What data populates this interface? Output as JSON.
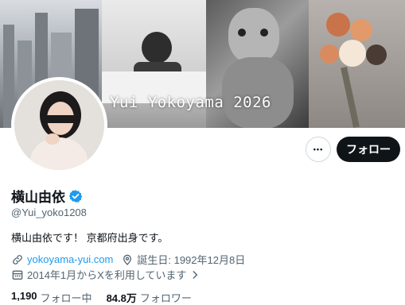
{
  "banner": {
    "text": "Yui Yokoyama 2026"
  },
  "profile": {
    "display_name": "横山由依",
    "handle": "@Yui_yoko1208",
    "bio": "横山由依です！ 京都府出身です。",
    "link": "yokoyama-yui.com",
    "birthday": "誕生日: 1992年12月8日",
    "joined": "2014年1月からXを利用しています"
  },
  "actions": {
    "more_label": "•••",
    "follow_label": "フォロー"
  },
  "stats": {
    "following_count": "1,190",
    "following_label": "フォロー中",
    "followers_count": "84.8万",
    "followers_label": "フォロワー"
  },
  "colors": {
    "accent": "#1d9bf0",
    "text": "#0f1419",
    "muted": "#536471",
    "button_dark": "#0f1419"
  },
  "icons": [
    "verified-badge-icon",
    "link-icon",
    "location-pin-icon",
    "calendar-icon",
    "chevron-right-icon",
    "more-icon"
  ]
}
